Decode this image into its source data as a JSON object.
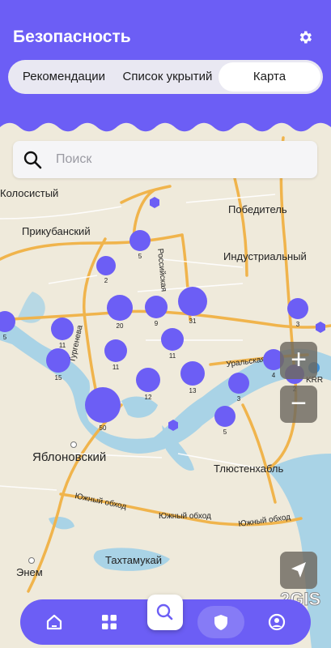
{
  "header": {
    "title": "Безопасность",
    "tabs": [
      {
        "label": "Рекомендации",
        "active": false
      },
      {
        "label": "Список укрытий",
        "active": false
      },
      {
        "label": "Карта",
        "active": true
      }
    ],
    "accent_color": "#6c5ef5"
  },
  "search": {
    "placeholder": "Поиск"
  },
  "map": {
    "labels": {
      "kolosisty": "Колосистый",
      "pobeditel": "Победитель",
      "prikubansky": "Прикубанский",
      "industrialny": "Индустриальный",
      "rossiyskaya": "Российская",
      "turgeneva": "Тургенева",
      "uralskaya": "Уральская",
      "krr": "KRR",
      "yablonovsky": "Яблоновский",
      "tlyustenkhabl": "Тлюстенхабль",
      "yuzhny1": "Южный обход",
      "yuzhny2": "Южный обход",
      "yuzhny3": "Южный обход",
      "takhtamukay": "Тахтамукай",
      "enem": "Энем"
    },
    "clusters": [
      {
        "id": "c5a",
        "count": "5"
      },
      {
        "id": "c2",
        "count": "2"
      },
      {
        "id": "c5b",
        "count": "5"
      },
      {
        "id": "c20",
        "count": "20"
      },
      {
        "id": "c9",
        "count": "9"
      },
      {
        "id": "c31",
        "count": "31"
      },
      {
        "id": "c3a",
        "count": "3"
      },
      {
        "id": "c11a",
        "count": "11"
      },
      {
        "id": "c11b",
        "count": "11"
      },
      {
        "id": "c11c",
        "count": "11"
      },
      {
        "id": "c15",
        "count": "15"
      },
      {
        "id": "c12",
        "count": "12"
      },
      {
        "id": "c13",
        "count": "13"
      },
      {
        "id": "c3b",
        "count": "3"
      },
      {
        "id": "c4",
        "count": "4"
      },
      {
        "id": "c2b",
        "count": "2"
      },
      {
        "id": "c50",
        "count": "50"
      },
      {
        "id": "c5c",
        "count": "5"
      }
    ],
    "provider_watermark": "2GIS",
    "zoom_in": "+",
    "zoom_out": "−"
  },
  "nav": {
    "items": [
      "home-icon",
      "grid-icon",
      "search-icon",
      "shield-icon",
      "profile-icon"
    ],
    "active": "shield-icon"
  }
}
